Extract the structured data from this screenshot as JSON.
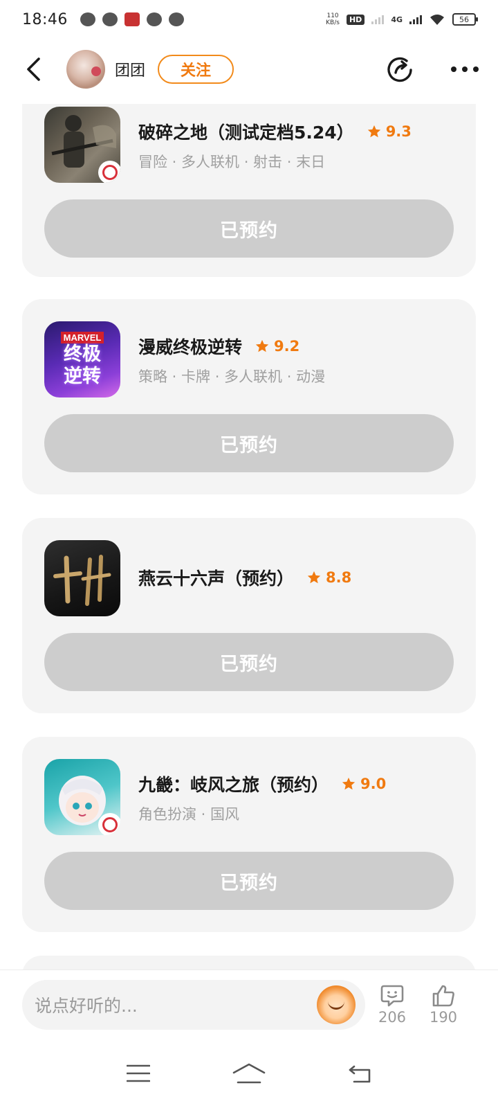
{
  "status_bar": {
    "time": "18:46",
    "net_speed_value": "110",
    "net_speed_unit": "KB/s",
    "hd_label": "HD",
    "network_type": "4G",
    "battery": "56"
  },
  "header": {
    "username": "团团",
    "follow_label": "关注"
  },
  "games": [
    {
      "title": "破碎之地（测试定档5.24）",
      "rating": "9.3",
      "tags": "冒险 · 多人联机 · 射击 · 末日",
      "button_label": "已预约"
    },
    {
      "title": "漫威终极逆转",
      "rating": "9.2",
      "tags": "策略 · 卡牌 · 多人联机 · 动漫",
      "button_label": "已预约",
      "icon_text_top": "MARVEL",
      "icon_text_mid": "终极",
      "icon_text_bot": "逆转"
    },
    {
      "title": "燕云十六声（预约）",
      "rating": "8.8",
      "tags": "",
      "button_label": "已预约"
    },
    {
      "title": "九畿：岐风之旅（预约）",
      "rating": "9.0",
      "tags": "角色扮演 · 国风",
      "button_label": "已预约"
    }
  ],
  "comment_bar": {
    "placeholder": "说点好听的...",
    "comment_count": "206",
    "like_count": "190"
  },
  "colors": {
    "accent": "#f07a10",
    "card_bg": "#f4f4f4",
    "reserved_button_bg": "#cdcdcd",
    "tag_text": "#a0a0a0"
  },
  "icons": {
    "back": "back-arrow-icon",
    "share": "share-icon",
    "more": "more-dots-icon",
    "star": "star-icon",
    "comment": "comment-icon",
    "like": "thumbs-up-icon",
    "menu": "menu-icon",
    "home": "home-icon",
    "return": "return-icon"
  }
}
